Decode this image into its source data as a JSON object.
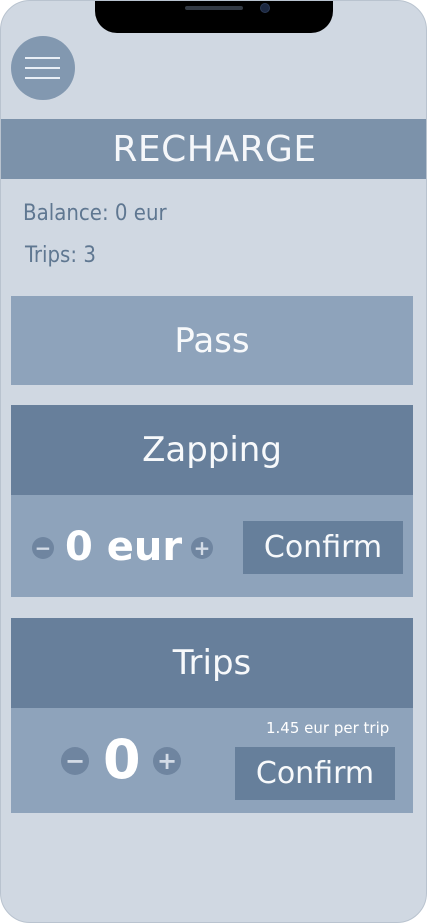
{
  "header": {
    "title": "RECHARGE"
  },
  "menu": {
    "icon": "hamburger-menu-icon"
  },
  "account": {
    "balance": "Balance: 0 eur",
    "trips": "Trips: 3"
  },
  "pass": {
    "label": "Pass"
  },
  "zapping": {
    "title": "Zapping",
    "amount": "0 eur",
    "minus_icon": "minus-circle-icon",
    "plus_icon": "plus-circle-icon",
    "confirm_label": "Confirm"
  },
  "trips_section": {
    "title": "Trips",
    "count": "0",
    "price_note": "1.45 eur per trip",
    "minus_icon": "minus-circle-icon",
    "plus_icon": "plus-circle-icon",
    "confirm_label": "Confirm"
  },
  "colors": {
    "background": "#d0d8e2",
    "header_bar": "#7c92aa",
    "section_head": "#677f9b",
    "section_body": "#8ea3bb",
    "text_muted": "#5f7791"
  }
}
